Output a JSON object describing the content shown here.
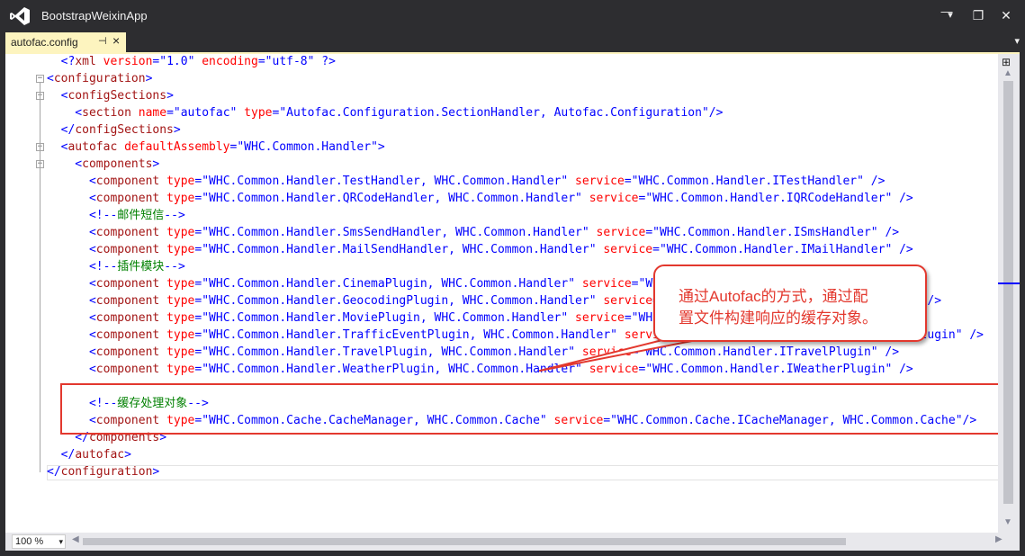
{
  "window": {
    "title": "BootstrapWeixinApp",
    "pin_glyph": "▾",
    "min_glyph": "—",
    "max_glyph": "❐",
    "close_glyph": "✕"
  },
  "tab": {
    "label": "autofac.config",
    "pin_glyph": "⊣",
    "close_glyph": "×",
    "dropdown_glyph": "▾"
  },
  "code_lines": [
    [
      [
        "v",
        "  <?"
      ],
      [
        "t",
        "xml"
      ],
      [
        "a",
        " version"
      ],
      [
        "v",
        "=\""
      ],
      [
        "v",
        "1.0"
      ],
      [
        "v",
        "\""
      ],
      [
        "a",
        " encoding"
      ],
      [
        "v",
        "=\""
      ],
      [
        "v",
        "utf-8"
      ],
      [
        "v",
        "\""
      ],
      [
        "v",
        " ?>"
      ]
    ],
    [
      [
        "v",
        "<"
      ],
      [
        "t",
        "configuration"
      ],
      [
        "v",
        ">"
      ]
    ],
    [
      [
        "v",
        "  <"
      ],
      [
        "t",
        "configSections"
      ],
      [
        "v",
        ">"
      ]
    ],
    [
      [
        "v",
        "    <"
      ],
      [
        "t",
        "section"
      ],
      [
        "a",
        " name"
      ],
      [
        "v",
        "=\""
      ],
      [
        "v",
        "autofac"
      ],
      [
        "v",
        "\""
      ],
      [
        "a",
        " type"
      ],
      [
        "v",
        "=\""
      ],
      [
        "v",
        "Autofac.Configuration.SectionHandler, Autofac.Configuration"
      ],
      [
        "v",
        "\"/>"
      ]
    ],
    [
      [
        "v",
        "  </"
      ],
      [
        "t",
        "configSections"
      ],
      [
        "v",
        ">"
      ]
    ],
    [
      [
        "v",
        "  <"
      ],
      [
        "t",
        "autofac"
      ],
      [
        "a",
        " defaultAssembly"
      ],
      [
        "v",
        "=\""
      ],
      [
        "v",
        "WHC.Common.Handler"
      ],
      [
        "v",
        "\">"
      ]
    ],
    [
      [
        "v",
        "    <"
      ],
      [
        "t",
        "components"
      ],
      [
        "v",
        ">"
      ]
    ],
    [
      [
        "v",
        "      <"
      ],
      [
        "t",
        "component"
      ],
      [
        "a",
        " type"
      ],
      [
        "v",
        "=\""
      ],
      [
        "v",
        "WHC.Common.Handler.TestHandler, WHC.Common.Handler"
      ],
      [
        "v",
        "\""
      ],
      [
        "a",
        " service"
      ],
      [
        "v",
        "=\""
      ],
      [
        "v",
        "WHC.Common.Handler.ITestHandler"
      ],
      [
        "v",
        "\" />"
      ]
    ],
    [
      [
        "v",
        "      <"
      ],
      [
        "t",
        "component"
      ],
      [
        "a",
        " type"
      ],
      [
        "v",
        "=\""
      ],
      [
        "v",
        "WHC.Common.Handler.QRCodeHandler, WHC.Common.Handler"
      ],
      [
        "v",
        "\""
      ],
      [
        "a",
        " service"
      ],
      [
        "v",
        "=\""
      ],
      [
        "v",
        "WHC.Common.Handler.IQRCodeHandler"
      ],
      [
        "v",
        "\" />"
      ]
    ],
    [
      [
        "v",
        "      <!--"
      ],
      [
        "cm",
        "邮件短信"
      ],
      [
        "v",
        "-->"
      ]
    ],
    [
      [
        "v",
        "      <"
      ],
      [
        "t",
        "component"
      ],
      [
        "a",
        " type"
      ],
      [
        "v",
        "=\""
      ],
      [
        "v",
        "WHC.Common.Handler.SmsSendHandler, WHC.Common.Handler"
      ],
      [
        "v",
        "\""
      ],
      [
        "a",
        " service"
      ],
      [
        "v",
        "=\""
      ],
      [
        "v",
        "WHC.Common.Handler.ISmsHandler"
      ],
      [
        "v",
        "\" />"
      ]
    ],
    [
      [
        "v",
        "      <"
      ],
      [
        "t",
        "component"
      ],
      [
        "a",
        " type"
      ],
      [
        "v",
        "=\""
      ],
      [
        "v",
        "WHC.Common.Handler.MailSendHandler, WHC.Common.Handler"
      ],
      [
        "v",
        "\""
      ],
      [
        "a",
        " service"
      ],
      [
        "v",
        "=\""
      ],
      [
        "v",
        "WHC.Common.Handler.IMailHandler"
      ],
      [
        "v",
        "\" />"
      ]
    ],
    [
      [
        "v",
        "      <!--"
      ],
      [
        "cm",
        "插件模块"
      ],
      [
        "v",
        "-->"
      ]
    ],
    [
      [
        "v",
        "      <"
      ],
      [
        "t",
        "component"
      ],
      [
        "a",
        " type"
      ],
      [
        "v",
        "=\""
      ],
      [
        "v",
        "WHC.Common.Handler.CinemaPlugin, WHC.Common.Handler"
      ],
      [
        "v",
        "\""
      ],
      [
        "a",
        " service"
      ],
      [
        "v",
        "=\""
      ],
      [
        "v",
        "WHC.Common.Handler.ICinemaPlugin"
      ],
      [
        "v",
        "\" />"
      ]
    ],
    [
      [
        "v",
        "      <"
      ],
      [
        "t",
        "component"
      ],
      [
        "a",
        " type"
      ],
      [
        "v",
        "=\""
      ],
      [
        "v",
        "WHC.Common.Handler.GeocodingPlugin, WHC.Common.Handler"
      ],
      [
        "v",
        "\""
      ],
      [
        "a",
        " service"
      ],
      [
        "v",
        "=\""
      ],
      [
        "v",
        "WHC.Common.Handler.IGeocodingPlugin"
      ],
      [
        "v",
        "\" />"
      ]
    ],
    [
      [
        "v",
        "      <"
      ],
      [
        "t",
        "component"
      ],
      [
        "a",
        " type"
      ],
      [
        "v",
        "=\""
      ],
      [
        "v",
        "WHC.Common.Handler.MoviePlugin, WHC.Common.Handler"
      ],
      [
        "v",
        "\""
      ],
      [
        "a",
        " service"
      ],
      [
        "v",
        "=\""
      ],
      [
        "v",
        "WHC.Common.Handler.IMoviePlugin"
      ],
      [
        "v",
        "\" />"
      ]
    ],
    [
      [
        "v",
        "      <"
      ],
      [
        "t",
        "component"
      ],
      [
        "a",
        " type"
      ],
      [
        "v",
        "=\""
      ],
      [
        "v",
        "WHC.Common.Handler.TrafficEventPlugin, WHC.Common.Handler"
      ],
      [
        "v",
        "\""
      ],
      [
        "a",
        " service"
      ],
      [
        "v",
        "=\""
      ],
      [
        "v",
        "WHC.Common.Handler.ITrafficEventPlugin"
      ],
      [
        "v",
        "\" />"
      ]
    ],
    [
      [
        "v",
        "      <"
      ],
      [
        "t",
        "component"
      ],
      [
        "a",
        " type"
      ],
      [
        "v",
        "=\""
      ],
      [
        "v",
        "WHC.Common.Handler.TravelPlugin, WHC.Common.Handler"
      ],
      [
        "v",
        "\""
      ],
      [
        "a",
        " service"
      ],
      [
        "v",
        "=\""
      ],
      [
        "v",
        "WHC.Common.Handler.ITravelPlugin"
      ],
      [
        "v",
        "\" />"
      ]
    ],
    [
      [
        "v",
        "      <"
      ],
      [
        "t",
        "component"
      ],
      [
        "a",
        " type"
      ],
      [
        "v",
        "=\""
      ],
      [
        "v",
        "WHC.Common.Handler.WeatherPlugin, WHC.Common.Handler"
      ],
      [
        "v",
        "\""
      ],
      [
        "a",
        " service"
      ],
      [
        "v",
        "=\""
      ],
      [
        "v",
        "WHC.Common.Handler.IWeatherPlugin"
      ],
      [
        "v",
        "\" />"
      ]
    ],
    [],
    [
      [
        "v",
        "      <!--"
      ],
      [
        "cm",
        "缓存处理对象"
      ],
      [
        "v",
        "-->"
      ]
    ],
    [
      [
        "v",
        "      <"
      ],
      [
        "t",
        "component"
      ],
      [
        "a",
        " type"
      ],
      [
        "v",
        "=\""
      ],
      [
        "v",
        "WHC.Common.Cache.CacheManager, WHC.Common.Cache"
      ],
      [
        "v",
        "\""
      ],
      [
        "a",
        " service"
      ],
      [
        "v",
        "=\""
      ],
      [
        "v",
        "WHC.Common.Cache.ICacheManager, WHC.Common.Cache"
      ],
      [
        "v",
        "\"/>"
      ]
    ],
    [
      [
        "v",
        "    </"
      ],
      [
        "t",
        "components"
      ],
      [
        "v",
        ">"
      ]
    ],
    [
      [
        "v",
        "  </"
      ],
      [
        "t",
        "autofac"
      ],
      [
        "v",
        ">"
      ]
    ],
    [
      [
        "v",
        "</"
      ],
      [
        "t",
        "configuration"
      ],
      [
        "v",
        ">"
      ]
    ]
  ],
  "fold_glyph": "−",
  "callout": {
    "text_line1": "通过Autofac的方式，通过配",
    "text_line2": "置文件构建响应的缓存对象。"
  },
  "statusbar": {
    "zoom": "100 %",
    "zoom_arrow": "▾",
    "left_arrow": "◀",
    "right_arrow": "▶"
  },
  "scrollbar": {
    "up_arrow": "▲",
    "down_arrow": "▼",
    "split_glyph": "⊞"
  },
  "colors": {
    "tag": "#a31515",
    "attribute": "#ff0000",
    "value": "#0000ff",
    "comment": "#008000",
    "annotation_red": "#e3382e",
    "tab_active": "#fdf4bf",
    "chrome": "#2d2d30"
  }
}
